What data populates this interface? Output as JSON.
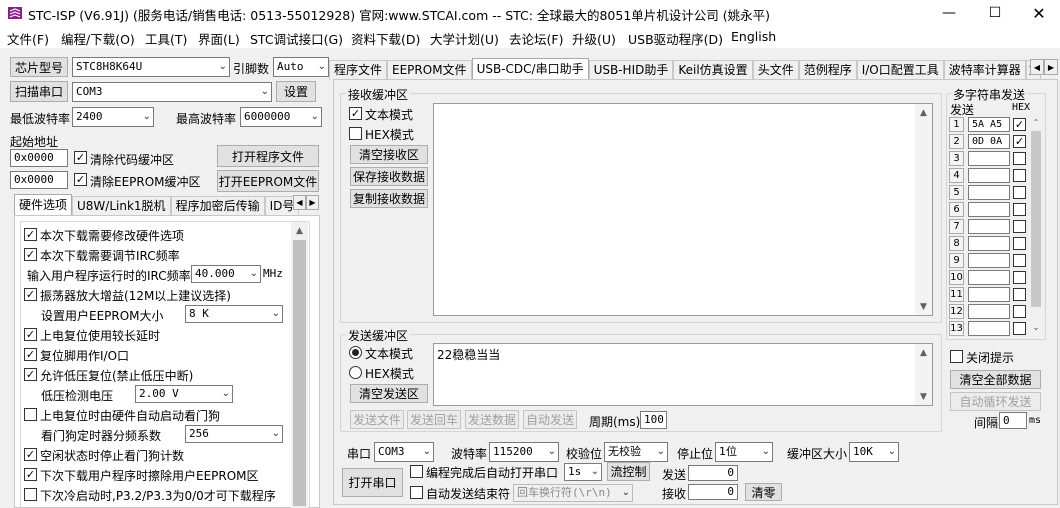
{
  "window": {
    "title": "STC-ISP (V6.91J) (服务电话/销售电话: 0513-55012928) 官网:www.STCAI.com  -- STC: 全球最大的8051单片机设计公司 (姚永平)"
  },
  "menu": [
    "文件(F)",
    "编程/下载(O)",
    "工具(T)",
    "界面(L)",
    "STC调试接口(G)",
    "资料下载(D)",
    "大学计划(U)",
    "去论坛(F)",
    "升级(U)",
    "USB驱动程序(D)",
    "English"
  ],
  "left": {
    "chip_label": "芯片型号",
    "chip_value": "STC8H8K64U",
    "pin_label": "引脚数",
    "pin_value": "Auto",
    "scan_btn": "扫描串口",
    "port_value": "COM3",
    "settings_btn": "设置",
    "min_baud_label": "最低波特率",
    "min_baud": "2400",
    "max_baud_label": "最高波特率",
    "max_baud": "6000000",
    "start_addr_label": "起始地址",
    "addr1": "0x0000",
    "clear_code": "清除代码缓冲区",
    "open_prog_btn": "打开程序文件",
    "addr2": "0x0000",
    "clear_eeprom": "清除EEPROM缓冲区",
    "open_eeprom_btn": "打开EEPROM文件",
    "tabs": [
      "硬件选项",
      "U8W/Link1脱机",
      "程序加密后传输",
      "ID号"
    ],
    "opts": {
      "o1": "本次下载需要修改硬件选项",
      "o2": "本次下载需要调节IRC频率",
      "irc_label": "输入用户程序运行时的IRC频率",
      "irc_value": "40.000",
      "irc_unit": "MHz",
      "o3": "振荡器放大增益(12M以上建议选择)",
      "eeprom_label": "设置用户EEPROM大小",
      "eeprom_value": "8    K",
      "o4": "上电复位使用较长延时",
      "o5": "复位脚用作I/O口",
      "o6": "允许低压复位(禁止低压中断)",
      "lv_label": "低压检测电压",
      "lv_value": "2.00 V",
      "o7": "上电复位时由硬件自动启动看门狗",
      "wd_label": "看门狗定时器分频系数",
      "wd_value": "256",
      "o8": "空闲状态时停止看门狗计数",
      "o9": "下次下载用户程序时擦除用户EEPROM区",
      "o10": "下次冷启动时,P3.2/P3.3为0/0才可下载程序"
    }
  },
  "right_tabs": [
    "程序文件",
    "EEPROM文件",
    "USB-CDC/串口助手",
    "USB-HID助手",
    "Keil仿真设置",
    "头文件",
    "范例程序",
    "I/O口配置工具",
    "波特率计算器",
    "定"
  ],
  "recv": {
    "title": "接收缓冲区",
    "text_mode": "文本模式",
    "hex_mode": "HEX模式",
    "clear_btn": "清空接收区",
    "save_btn": "保存接收数据",
    "copy_btn": "复制接收数据"
  },
  "send": {
    "title": "发送缓冲区",
    "text_mode": "文本模式",
    "hex_mode": "HEX模式",
    "clear_btn": "清空发送区",
    "content": "22稳稳当当",
    "btn_file": "发送文件",
    "btn_back": "发送回车",
    "btn_data": "发送数据",
    "btn_auto": "自动发送",
    "period_label": "周期(ms)",
    "period_value": "100"
  },
  "multi": {
    "title": "多字符串发送",
    "col_send": "发送",
    "col_hex": "HEX",
    "rows": [
      {
        "n": "1",
        "v": "5A A5 ."
      },
      {
        "n": "2",
        "v": "0D 0A"
      },
      {
        "n": "3",
        "v": ""
      },
      {
        "n": "4",
        "v": ""
      },
      {
        "n": "5",
        "v": ""
      },
      {
        "n": "6",
        "v": ""
      },
      {
        "n": "7",
        "v": ""
      },
      {
        "n": "8",
        "v": ""
      },
      {
        "n": "9",
        "v": ""
      },
      {
        "n": "10",
        "v": ""
      },
      {
        "n": "11",
        "v": ""
      },
      {
        "n": "12",
        "v": ""
      },
      {
        "n": "13",
        "v": ""
      }
    ],
    "hex_checked": [
      true,
      true,
      false,
      false,
      false,
      false,
      false,
      false,
      false,
      false,
      false,
      false,
      false
    ],
    "close_tip": "关闭提示",
    "clear_all_btn": "清空全部数据",
    "loop_btn": "自动循环发送",
    "interval_label": "间隔",
    "interval_value": "0",
    "interval_unit": "ms"
  },
  "serial": {
    "port_label": "串口",
    "port_value": "COM3",
    "baud_label": "波特率",
    "baud_value": "115200",
    "parity_label": "校验位",
    "parity_value": "无校验",
    "stop_label": "停止位",
    "stop_value": "1位",
    "buf_label": "缓冲区大小",
    "buf_value": "10K",
    "open_btn": "打开串口",
    "auto_open": "编程完成后自动打开串口",
    "auto_open_val": "1s",
    "flow_btn": "流控制",
    "auto_end": "自动发送结束符",
    "end_value": "回车换行符(\\r\\n)",
    "send_label": "发送",
    "send_count": "0",
    "recv_label": "接收",
    "recv_count": "0",
    "clear_btn": "清零"
  }
}
